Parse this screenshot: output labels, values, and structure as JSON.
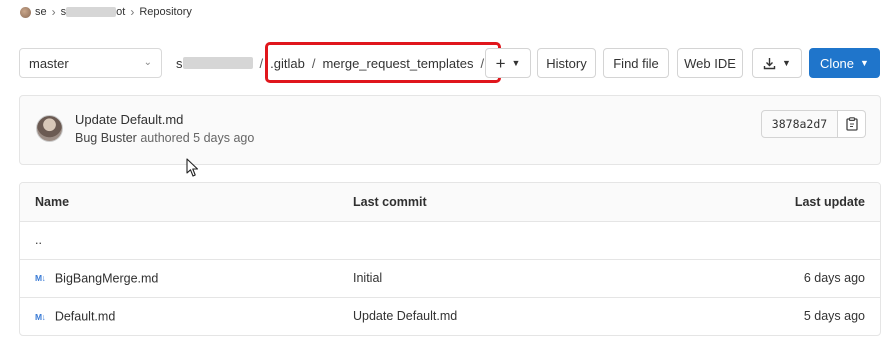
{
  "breadcrumb": {
    "group": "se",
    "project_prefix": "s",
    "project_suffix": "ot",
    "current": "Repository"
  },
  "toolbar": {
    "branch": "master",
    "path_root_prefix": "s",
    "path": [
      ".gitlab",
      "merge_request_templates"
    ],
    "path_sep": "/",
    "add_label": "+",
    "history_label": "History",
    "find_file_label": "Find file",
    "web_ide_label": "Web IDE",
    "clone_label": "Clone"
  },
  "commit": {
    "title": "Update Default.md",
    "author": "Bug Buster",
    "authored": "authored 5 days ago",
    "sha": "3878a2d7"
  },
  "table": {
    "headers": {
      "name": "Name",
      "last_commit": "Last commit",
      "last_update": "Last update"
    },
    "parent": "..",
    "rows": [
      {
        "name": "BigBangMerge.md",
        "icon": "markdown-icon",
        "commit": "Initial",
        "updated": "6 days ago"
      },
      {
        "name": "Default.md",
        "icon": "markdown-icon",
        "commit": "Update Default.md",
        "updated": "5 days ago"
      }
    ]
  },
  "colors": {
    "accent": "#1f75cb",
    "highlight": "#e0161c"
  }
}
